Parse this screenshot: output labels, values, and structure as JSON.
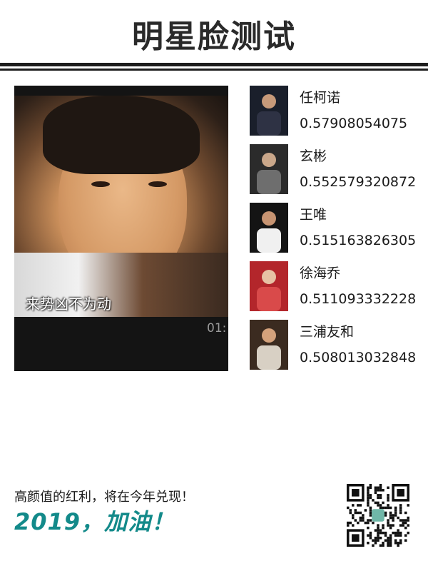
{
  "header": {
    "title": "明星脸测试"
  },
  "video": {
    "subtitle": "来势凶不为动",
    "time": "01:"
  },
  "matches": [
    {
      "name": "任柯诺",
      "score": "0.57908054075",
      "avatar_colors": [
        "#1a1f2b",
        "#2e3244",
        "#c79a7a"
      ]
    },
    {
      "name": "玄彬",
      "score": "0.552579320872",
      "avatar_colors": [
        "#2b2b2b",
        "#6e6e6e",
        "#caa78a"
      ]
    },
    {
      "name": "王唯",
      "score": "0.515163826305",
      "avatar_colors": [
        "#141414",
        "#f0f0f0",
        "#c79472"
      ]
    },
    {
      "name": "徐海乔",
      "score": "0.511093332228",
      "avatar_colors": [
        "#b3262b",
        "#d94a4a",
        "#e7c2a4"
      ]
    },
    {
      "name": "三浦友和",
      "score": "0.508013032848",
      "avatar_colors": [
        "#3b2b20",
        "#d8d0c4",
        "#d4a27c"
      ]
    }
  ],
  "footer": {
    "slogan": "高颜值的红利，将在今年兑现！",
    "tagline": "2019，加油！",
    "qr_icon": "qr-code-icon"
  },
  "colors": {
    "accent": "#138a8a",
    "rule": "#1d1d1d"
  }
}
